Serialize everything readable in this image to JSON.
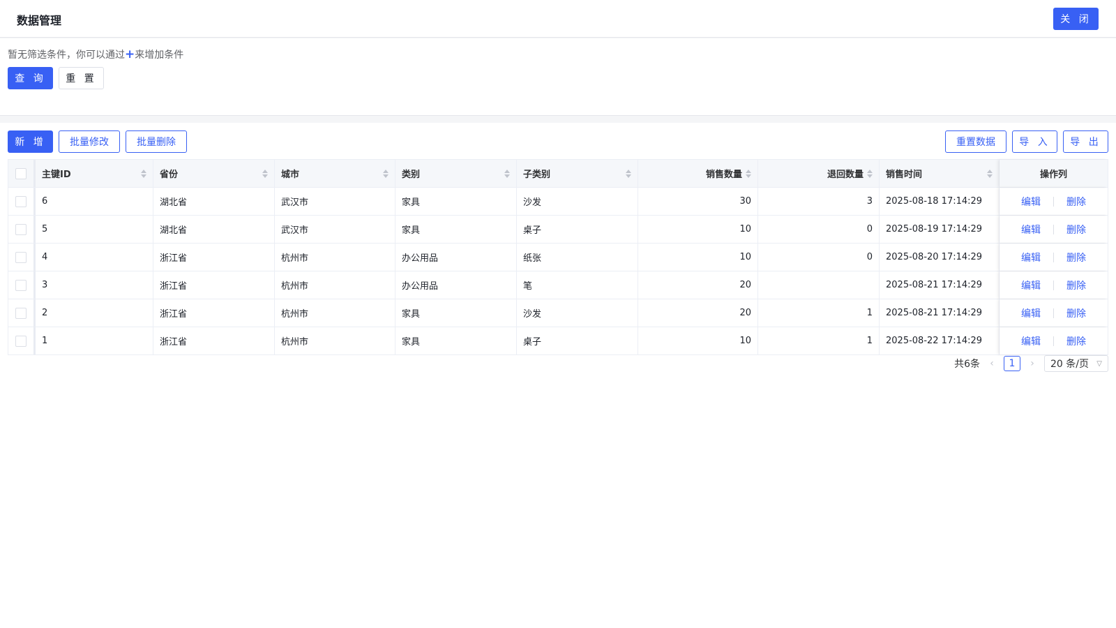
{
  "header": {
    "title": "数据管理",
    "close_label": "关 闭"
  },
  "filter": {
    "hint_before": "暂无筛选条件，你可以通过",
    "hint_plus": "+",
    "hint_after": "来增加条件",
    "query_label": "查 询",
    "reset_label": "重 置"
  },
  "toolbar": {
    "add_label": "新 增",
    "batch_edit_label": "批量修改",
    "batch_delete_label": "批量删除",
    "reset_data_label": "重置数据",
    "import_label": "导 入",
    "export_label": "导 出"
  },
  "table": {
    "columns": {
      "id": "主键ID",
      "province": "省份",
      "city": "城市",
      "category": "类别",
      "subcategory": "子类别",
      "sales_qty": "销售数量",
      "return_qty": "退回数量",
      "sales_time": "销售时间",
      "operations": "操作列"
    },
    "edit_label": "编辑",
    "delete_label": "删除",
    "rows": [
      {
        "id": "6",
        "province": "湖北省",
        "city": "武汉市",
        "category": "家具",
        "subcategory": "沙发",
        "sales_qty": "30",
        "return_qty": "3",
        "sales_time": "2025-08-18 17:14:29"
      },
      {
        "id": "5",
        "province": "湖北省",
        "city": "武汉市",
        "category": "家具",
        "subcategory": "桌子",
        "sales_qty": "10",
        "return_qty": "0",
        "sales_time": "2025-08-19 17:14:29"
      },
      {
        "id": "4",
        "province": "浙江省",
        "city": "杭州市",
        "category": "办公用品",
        "subcategory": "纸张",
        "sales_qty": "10",
        "return_qty": "0",
        "sales_time": "2025-08-20 17:14:29"
      },
      {
        "id": "3",
        "province": "浙江省",
        "city": "杭州市",
        "category": "办公用品",
        "subcategory": "笔",
        "sales_qty": "20",
        "return_qty": "",
        "sales_time": "2025-08-21 17:14:29"
      },
      {
        "id": "2",
        "province": "浙江省",
        "city": "杭州市",
        "category": "家具",
        "subcategory": "沙发",
        "sales_qty": "20",
        "return_qty": "1",
        "sales_time": "2025-08-21 17:14:29"
      },
      {
        "id": "1",
        "province": "浙江省",
        "city": "杭州市",
        "category": "家具",
        "subcategory": "桌子",
        "sales_qty": "10",
        "return_qty": "1",
        "sales_time": "2025-08-22 17:14:29"
      }
    ]
  },
  "pagination": {
    "total_label": "共6条",
    "current_page": "1",
    "page_size_label": "20 条/页"
  }
}
